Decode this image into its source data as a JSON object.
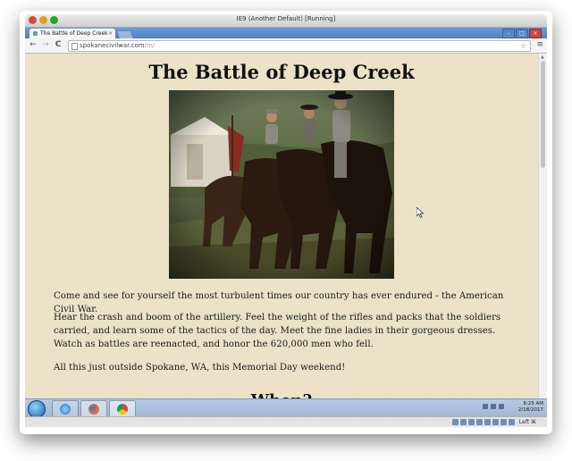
{
  "vm_window": {
    "title": "IE9 (Another Default) [Running]"
  },
  "browser": {
    "tab_title": "The Battle of Deep Creek",
    "tab_close": "×",
    "url_host": "spokanecivilwar.com",
    "url_path": "/m/",
    "back_glyph": "←",
    "forward_glyph": "→",
    "reload_glyph": "C",
    "star_glyph": "☆",
    "menu_glyph": "≡",
    "window_controls": [
      "–",
      "□",
      "×"
    ]
  },
  "page": {
    "title": "The Battle of Deep Creek",
    "paragraphs": [
      "Come and see for yourself the most turbulent times our country has ever endured - the American Civil War.",
      "Hear the crash and boom of the artillery. Feel the weight of the rifles and packs that the soldiers carried, and learn some of the tactics of the day. Meet the fine ladies in their gorgeous dresses. Watch as battles are reenacted, and honor the 620,000 men who fell.",
      "All this just outside Spokane, WA, this Memorial Day weekend!"
    ],
    "next_heading": "When?"
  },
  "taskbar": {
    "time": "8:25 AM",
    "date": "2/18/2017"
  },
  "vbox_status": {
    "host_key": "Left ⌘"
  },
  "icons": {
    "start": "windows-start-orb-icon",
    "ie": "internet-explorer-icon",
    "firefox": "firefox-icon",
    "chrome": "chrome-icon"
  }
}
